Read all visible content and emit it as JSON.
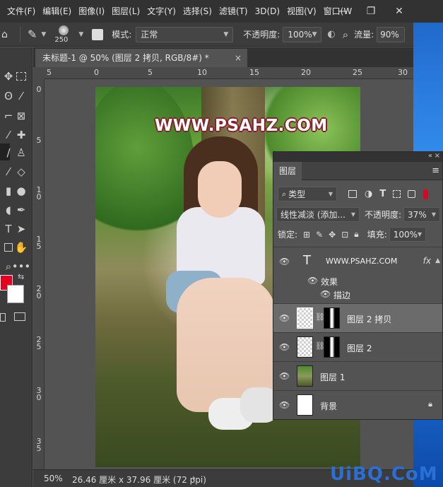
{
  "menubar": {
    "items": [
      "文件(F)",
      "编辑(E)",
      "图像(I)",
      "图层(L)",
      "文字(Y)",
      "选择(S)",
      "滤镜(T)",
      "3D(D)",
      "视图(V)",
      "窗口(W"
    ],
    "window_controls": [
      "—",
      "❐",
      "✕"
    ]
  },
  "options_bar": {
    "brush_size": "250",
    "mode_label": "模式:",
    "mode_value": "正常",
    "opacity_label": "不透明度:",
    "opacity_value": "100%",
    "flow_label": "流量:",
    "flow_value": "90%"
  },
  "document_tab": {
    "title": "未标题-1 @ 50% (图层 2 拷贝, RGB/8#) *",
    "close": "×"
  },
  "ruler": {
    "top_labels": [
      "5",
      "0",
      "5",
      "10",
      "15",
      "20",
      "25",
      "30"
    ],
    "left_labels": [
      "0",
      "5",
      "1\n0",
      "1\n5",
      "2\n0",
      "2\n5",
      "3\n0",
      "3\n5"
    ]
  },
  "canvas": {
    "watermark_text": "WWW.PSAHZ.COM"
  },
  "status_bar": {
    "zoom": "50%",
    "doc_info": "26.46 厘米 x 37.96 厘米 (72 ppi)",
    "arrow": "›"
  },
  "layers_panel": {
    "tab_label": "图层",
    "filter_kind": "类型",
    "blend_mode": "线性减淡 (添加...",
    "opacity_label": "不透明度:",
    "opacity_value": "37%",
    "lock_label": "锁定:",
    "fill_label": "填充:",
    "fill_value": "100%",
    "layers": [
      {
        "name": "WWW.PSAHZ.COM",
        "type": "text",
        "fx": "fx"
      },
      {
        "name": "图层 2 拷贝",
        "type": "masked",
        "selected": true
      },
      {
        "name": "图层 2",
        "type": "masked"
      },
      {
        "name": "图层 1",
        "type": "image"
      },
      {
        "name": "背景",
        "type": "background",
        "locked": true
      }
    ],
    "effects_label": "效果",
    "stroke_label": "描边"
  },
  "brand": {
    "text": "UiBQ.CoM",
    "color": "#2a6fd6"
  }
}
